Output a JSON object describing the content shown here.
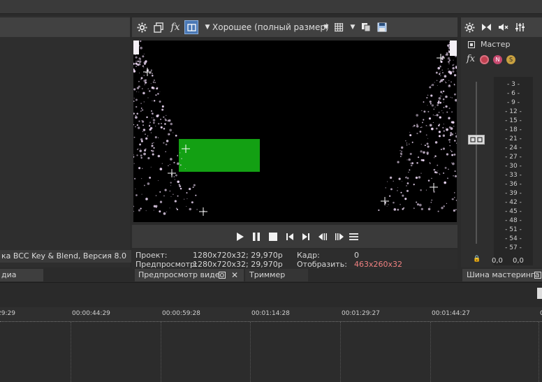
{
  "left": {
    "plugin_text": "ка BCC Key & Blend, Версия 8.0",
    "tab_label": "диа"
  },
  "preview": {
    "toolbar": {
      "settings_icon": "gear-icon",
      "copy_frame_icon": "copy-frame-icon",
      "fx_label": "fx",
      "split_icon": "split-screen-icon",
      "quality": "Хорошее (полный размер)",
      "grid_icon": "grid-icon",
      "copy_icon": "copy-icon",
      "save_icon": "save-icon"
    },
    "info": {
      "project_label": "Проект:",
      "project_value": "1280x720x32; 29,970p",
      "preview_label": "Предпросмотр:",
      "preview_value": "1280x720x32; 29,970p",
      "frame_label": "Кадр:",
      "frame_value": "0",
      "display_label": "Отобразить:",
      "display_value": "463x260x32"
    },
    "tab_label": "Предпросмотр видео",
    "trimmer_label": "Триммер",
    "colors": {
      "green_rect": "#13a013",
      "display_value": "#f08080"
    }
  },
  "mixer": {
    "master_label": "Мастер",
    "fx_label": "fx",
    "meter_ticks": [
      "3",
      "6",
      "9",
      "12",
      "15",
      "18",
      "21",
      "24",
      "27",
      "30",
      "33",
      "36",
      "39",
      "42",
      "45",
      "48",
      "51",
      "54",
      "57"
    ],
    "level_left": "0,0",
    "level_right": "0,0",
    "tab_label": "Шина мастеринга"
  },
  "timeline": {
    "marks": [
      "29:29",
      "00:00:44:29",
      "00:00:59:28",
      "00:01:14:28",
      "00:01:29:27",
      "00:01:44:27",
      "00:01"
    ]
  }
}
